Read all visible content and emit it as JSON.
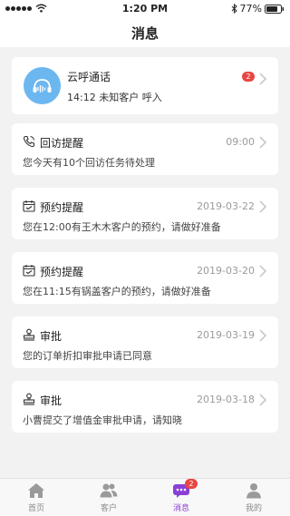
{
  "status_bar": {
    "time": "1:20 PM",
    "battery": "77%"
  },
  "header": {
    "title": "消息"
  },
  "call_card": {
    "title": "云呼通话",
    "subtitle": "14:12 未知客户 呼入",
    "badge": "2",
    "icon": "phone-sound-icon"
  },
  "messages": [
    {
      "title": "回访提醒",
      "date": "09:00",
      "body": "您今天有10个回访任务待处理",
      "icon": "phone-icon"
    },
    {
      "title": "预约提醒",
      "date": "2019-03-22",
      "body": "您在12:00有王木木客户的预约，请做好准备",
      "icon": "calendar-icon"
    },
    {
      "title": "预约提醒",
      "date": "2019-03-20",
      "body": "您在11:15有锅盖客户的预约，请做好准备",
      "icon": "calendar-icon"
    },
    {
      "title": "审批",
      "date": "2019-03-19",
      "body": "您的订单折扣审批申请已同意",
      "icon": "stamp-icon"
    },
    {
      "title": "审批",
      "date": "2019-03-18",
      "body": "小曹提交了增值金审批申请，请知晓",
      "icon": "stamp-icon"
    }
  ],
  "tabs": [
    {
      "label": "首页",
      "icon": "home-icon"
    },
    {
      "label": "客户",
      "icon": "customers-icon"
    },
    {
      "label": "消息",
      "icon": "message-icon",
      "badge": "2",
      "active": true
    },
    {
      "label": "我的",
      "icon": "profile-icon"
    }
  ],
  "colors": {
    "accent": "#8a3fd6",
    "badge": "#e94645",
    "avatar": "#6cb7ef"
  }
}
